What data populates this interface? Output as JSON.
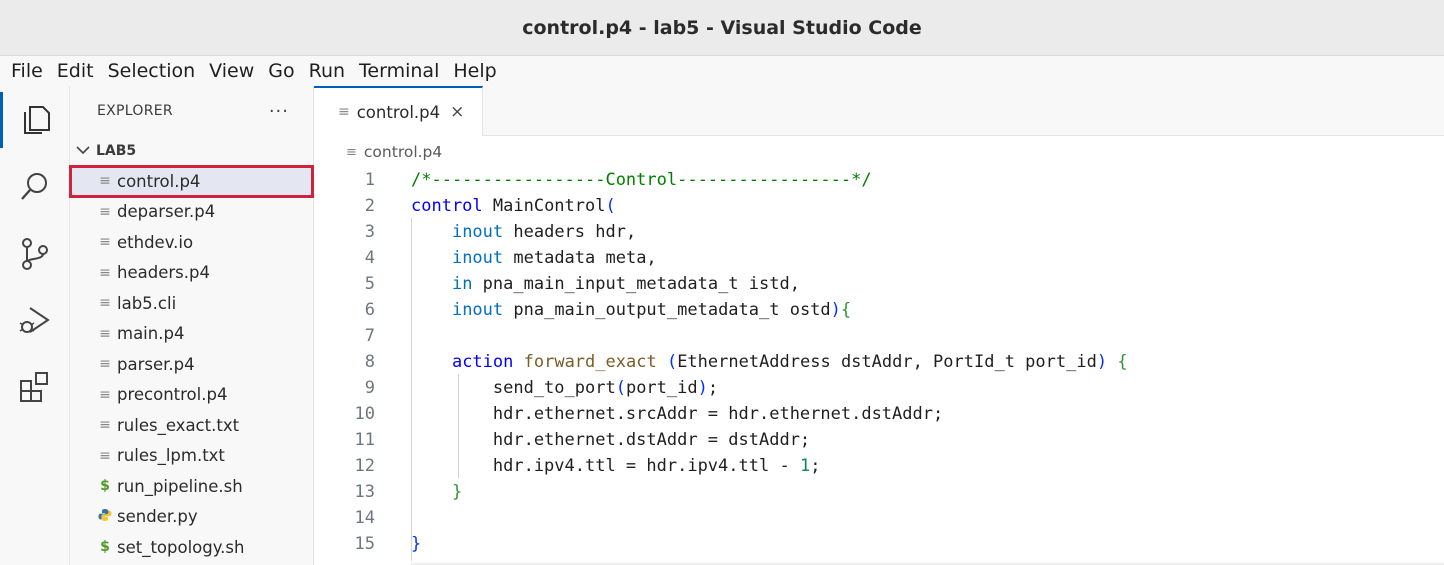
{
  "window": {
    "title": "control.p4 - lab5 - Visual Studio Code"
  },
  "menu": [
    "File",
    "Edit",
    "Selection",
    "View",
    "Go",
    "Run",
    "Terminal",
    "Help"
  ],
  "activity_bar": [
    "explorer-icon",
    "search-icon",
    "source-control-icon",
    "run-debug-icon",
    "extensions-icon"
  ],
  "explorer": {
    "title": "EXPLORER",
    "more": "···",
    "folder": "LAB5",
    "files": [
      {
        "name": "control.p4",
        "icon": "text-file-icon"
      },
      {
        "name": "deparser.p4",
        "icon": "text-file-icon"
      },
      {
        "name": "ethdev.io",
        "icon": "text-file-icon"
      },
      {
        "name": "headers.p4",
        "icon": "text-file-icon"
      },
      {
        "name": "lab5.cli",
        "icon": "text-file-icon"
      },
      {
        "name": "main.p4",
        "icon": "text-file-icon"
      },
      {
        "name": "parser.p4",
        "icon": "text-file-icon"
      },
      {
        "name": "precontrol.p4",
        "icon": "text-file-icon"
      },
      {
        "name": "rules_exact.txt",
        "icon": "text-file-icon"
      },
      {
        "name": "rules_lpm.txt",
        "icon": "text-file-icon"
      },
      {
        "name": "run_pipeline.sh",
        "icon": "shell-icon"
      },
      {
        "name": "sender.py",
        "icon": "python-icon"
      },
      {
        "name": "set_topology.sh",
        "icon": "shell-icon"
      }
    ],
    "selected": "control.p4"
  },
  "tab": {
    "label": "control.p4",
    "close": "×"
  },
  "breadcrumb": "control.p4",
  "editor": {
    "line_numbers": [
      "1",
      "2",
      "3",
      "4",
      "5",
      "6",
      "7",
      "8",
      "9",
      "10",
      "11",
      "12",
      "13",
      "14",
      "15"
    ],
    "lines": [
      "/*-----------------Control-----------------*/",
      "control MainControl(",
      "    inout headers hdr,",
      "    inout metadata meta,",
      "    in pna_main_input_metadata_t istd,",
      "    inout pna_main_output_metadata_t ostd){",
      "",
      "    action forward_exact (EthernetAddress dstAddr, PortId_t port_id) {",
      "        send_to_port(port_id);",
      "        hdr.ethernet.srcAddr = hdr.ethernet.dstAddr;",
      "        hdr.ethernet.dstAddr = dstAddr;",
      "        hdr.ipv4.ttl = hdr.ipv4.ttl - 1;",
      "    }",
      "",
      "}"
    ]
  },
  "colors": {
    "accent": "#005fb8",
    "selection_outline": "#d1223d",
    "comment": "#008000",
    "keyword": "#0000ff"
  }
}
